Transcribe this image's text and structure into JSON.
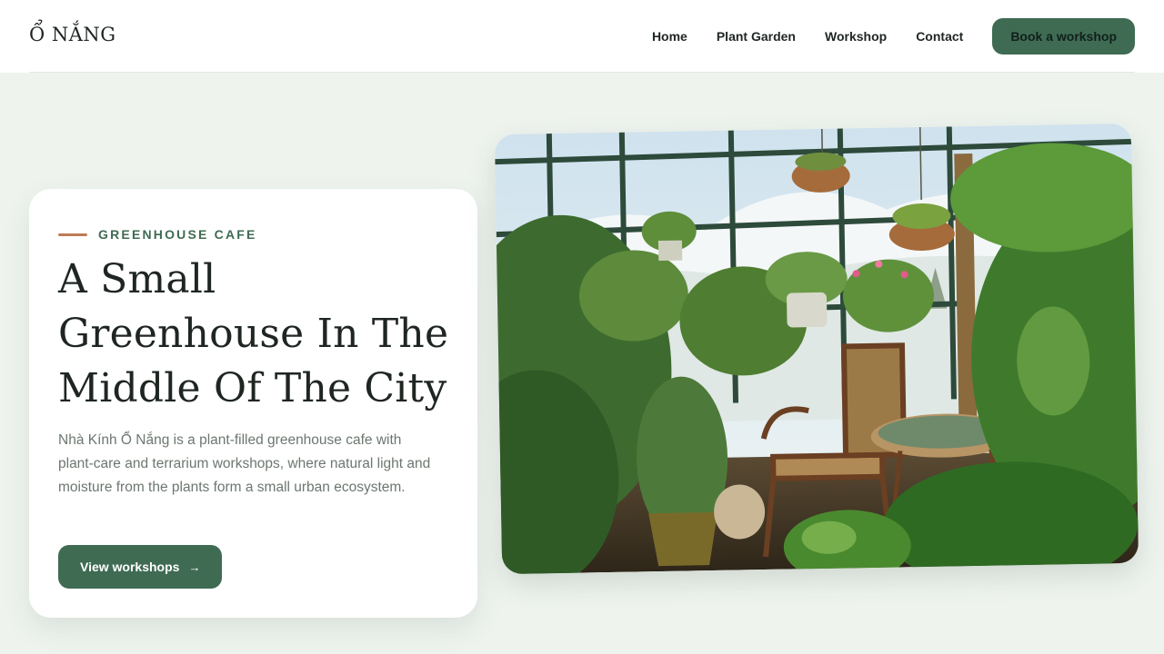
{
  "header": {
    "logo": "Ổ NẮNG",
    "nav": [
      "Home",
      "Plant Garden",
      "Workshop",
      "Contact"
    ],
    "cta": "Book a workshop"
  },
  "hero": {
    "eyebrow": "GREENHOUSE CAFE",
    "title_lines": [
      "A Small",
      "Greenhouse In The",
      "Middle Of The City"
    ],
    "description": "Nhà Kính Ổ Nắng is a plant-filled greenhouse cafe with plant-care and terrarium workshops, where natural light and moisture from the plants form a small urban ecosystem.",
    "button_label": "View workshops",
    "button_icon": "arrow-right-icon"
  },
  "colors": {
    "background": "#eef3ee",
    "accent": "#3f6b53",
    "eyebrow_line": "#c07a55"
  }
}
